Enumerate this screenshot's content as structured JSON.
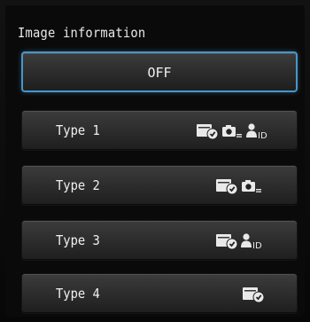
{
  "header": {
    "title": "Image information"
  },
  "options": [
    {
      "label": "OFF",
      "selected": true,
      "icons": []
    },
    {
      "label": "Type 1",
      "selected": false,
      "icons": [
        "card-check-icon",
        "camera-list-icon",
        "person-id-icon"
      ]
    },
    {
      "label": "Type 2",
      "selected": false,
      "icons": [
        "card-check-icon",
        "camera-list-icon"
      ]
    },
    {
      "label": "Type 3",
      "selected": false,
      "icons": [
        "card-check-icon",
        "person-id-icon"
      ]
    },
    {
      "label": "Type 4",
      "selected": false,
      "icons": [
        "card-check-icon"
      ]
    }
  ],
  "icon_labels": {
    "id_text": "ID"
  },
  "colors": {
    "selection_border": "#4a95c9",
    "background": "#0b0b0b",
    "text": "#f0f0f0"
  }
}
